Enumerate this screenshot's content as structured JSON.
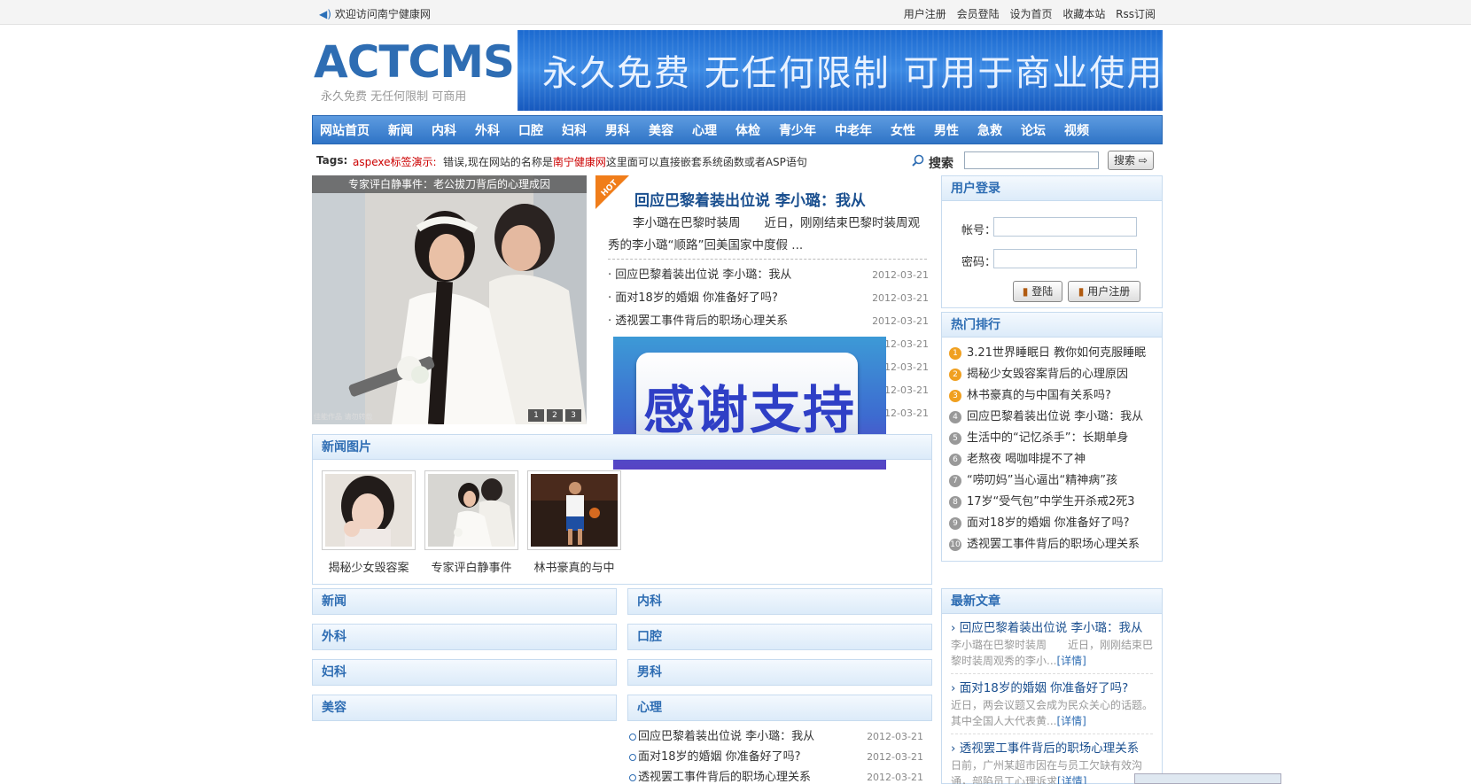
{
  "top": {
    "welcome": "欢迎访问南宁健康网",
    "links": [
      "用户注册",
      "会员登陆",
      "设为首页",
      "收藏本站",
      "Rss订阅"
    ]
  },
  "logo": {
    "brand": "ACTCMS",
    "slogan": "永久免费  无任何限制  可商用"
  },
  "banner": {
    "text": "永久免费  无任何限制  可用于商业使用"
  },
  "nav": [
    "网站首页",
    "新闻",
    "内科",
    "外科",
    "口腔",
    "妇科",
    "男科",
    "美容",
    "心理",
    "体检",
    "青少年",
    "中老年",
    "女性",
    "男性",
    "急救",
    "论坛",
    "视频"
  ],
  "tags": {
    "label": "Tags:",
    "demo": "aspexe标签演示:",
    "message_pre": "错误,现在网站的名称是",
    "message_site": "南宁健康网",
    "message_post": "这里面可以直接嵌套系统函数或者ASP语句"
  },
  "search": {
    "label": "搜索",
    "button": "搜索",
    "value": ""
  },
  "slideshow": {
    "caption": "专家评白静事件：老公拔刀背后的心理成因",
    "credit": "佳能作品 请勿转载",
    "dots": [
      "1",
      "2",
      "3"
    ]
  },
  "hot": {
    "badge": "HOT",
    "title": "回应巴黎着装出位说 李小璐：我从",
    "summary": "李小璐在巴黎时装周　　近日，刚刚结束巴黎时装周观秀的李小璐“顺路”回美国家中度假 ...",
    "items": [
      {
        "title": "回应巴黎着装出位说 李小璐：我从",
        "date": "2012-03-21"
      },
      {
        "title": "面对18岁的婚姻 你准备好了吗?",
        "date": "2012-03-21"
      },
      {
        "title": "透视罢工事件背后的职场心理关系",
        "date": "2012-03-21"
      },
      {
        "title": "",
        "date": "2012-03-21"
      },
      {
        "title": "",
        "date": "2012-03-21"
      },
      {
        "title": "",
        "date": "2012-03-21"
      },
      {
        "title": "",
        "date": "2012-03-21"
      }
    ]
  },
  "overlay": {
    "text": "感谢支持"
  },
  "login": {
    "title": "用户登录",
    "account_label": "帐号：",
    "password_label": "密码：",
    "login_button": "登陆",
    "register_button": "用户注册"
  },
  "ranking": {
    "title": "热门排行",
    "items": [
      "3.21世界睡眠日 教你如何克服睡眠",
      "揭秘少女毁容案背后的心理原因",
      "林书豪真的与中国有关系吗?",
      "回应巴黎着装出位说 李小璐：我从",
      "生活中的“记忆杀手”：长期单身",
      "老熬夜 喝咖啡提不了神",
      "“唠叨妈”当心逼出“精神病”孩",
      "17岁“受气包”中学生开杀戒2死3",
      "面对18岁的婚姻 你准备好了吗?",
      "透视罢工事件背后的职场心理关系"
    ],
    "nums": [
      "1",
      "2",
      "3",
      "4",
      "5",
      "6",
      "7",
      "8",
      "9",
      "10"
    ],
    "colors": {
      "top": "#f0a020",
      "rest": "#999999"
    }
  },
  "news_pics": {
    "title": "新闻图片",
    "items": [
      {
        "caption": "揭秘少女毁容案"
      },
      {
        "caption": "专家评白静事件"
      },
      {
        "caption": "林书豪真的与中"
      }
    ]
  },
  "categories": {
    "left": [
      "新闻",
      "外科",
      "妇科",
      "美容"
    ],
    "right": [
      "内科",
      "口腔",
      "男科",
      "心理"
    ],
    "psych_items": [
      {
        "title": "回应巴黎着装出位说 李小璐：我从",
        "date": "2012-03-21"
      },
      {
        "title": "面对18岁的婚姻 你准备好了吗?",
        "date": "2012-03-21"
      },
      {
        "title": "透视罢工事件背后的职场心理关系",
        "date": "2012-03-21"
      }
    ]
  },
  "latest": {
    "title": "最新文章",
    "items": [
      {
        "title": "回应巴黎着装出位说 李小璐：我从",
        "summary": "李小璐在巴黎时装周　　近日，刚刚结束巴黎时装周观秀的李小...",
        "more": "[详情]"
      },
      {
        "title": "面对18岁的婚姻 你准备好了吗?",
        "summary": "近日，两会议题又会成为民众关心的话题。其中全国人大代表黄...",
        "more": "[详情]"
      },
      {
        "title": "透视罢工事件背后的职场心理关系",
        "summary": "日前，广州某超市因在与员工欠缺有效沟通，部陷员工心理诉求",
        "more": "[详情]"
      }
    ]
  },
  "colors": {
    "accent": "#2e6db3",
    "nav_top": "#5d9be0",
    "nav_bottom": "#2f74c6",
    "link_red": "#cc0000"
  }
}
